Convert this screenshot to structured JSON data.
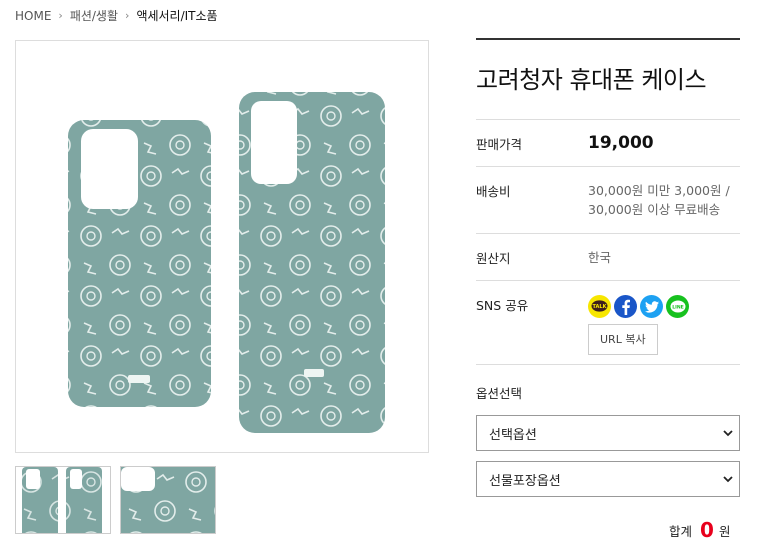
{
  "breadcrumb": {
    "items": [
      "HOME",
      "패션/생활",
      "액세서리/IT소품"
    ],
    "separator": "›"
  },
  "product": {
    "title": "고려청자 휴대폰 케이스",
    "case_color": "#7fa6a2",
    "pattern_color": "#e8f1ef"
  },
  "details": {
    "price_label": "판매가격",
    "price_value": "19,000",
    "shipping_label": "배송비",
    "shipping_line1": "30,000원 미만 3,000원 /",
    "shipping_line2": "30,000원 이상 무료배송",
    "origin_label": "원산지",
    "origin_value": "한국",
    "sns_label": "SNS 공유",
    "sns_icons": [
      "kakaotalk-icon",
      "facebook-icon",
      "twitter-icon",
      "line-icon"
    ],
    "kakao_text": "TALK",
    "line_text": "LINE",
    "url_copy_label": "URL 복사"
  },
  "options": {
    "title": "옵션선택",
    "select1": "선택옵션",
    "select2": "선물포장옵션"
  },
  "total": {
    "label": "합계",
    "amount": "0",
    "unit": "원"
  }
}
